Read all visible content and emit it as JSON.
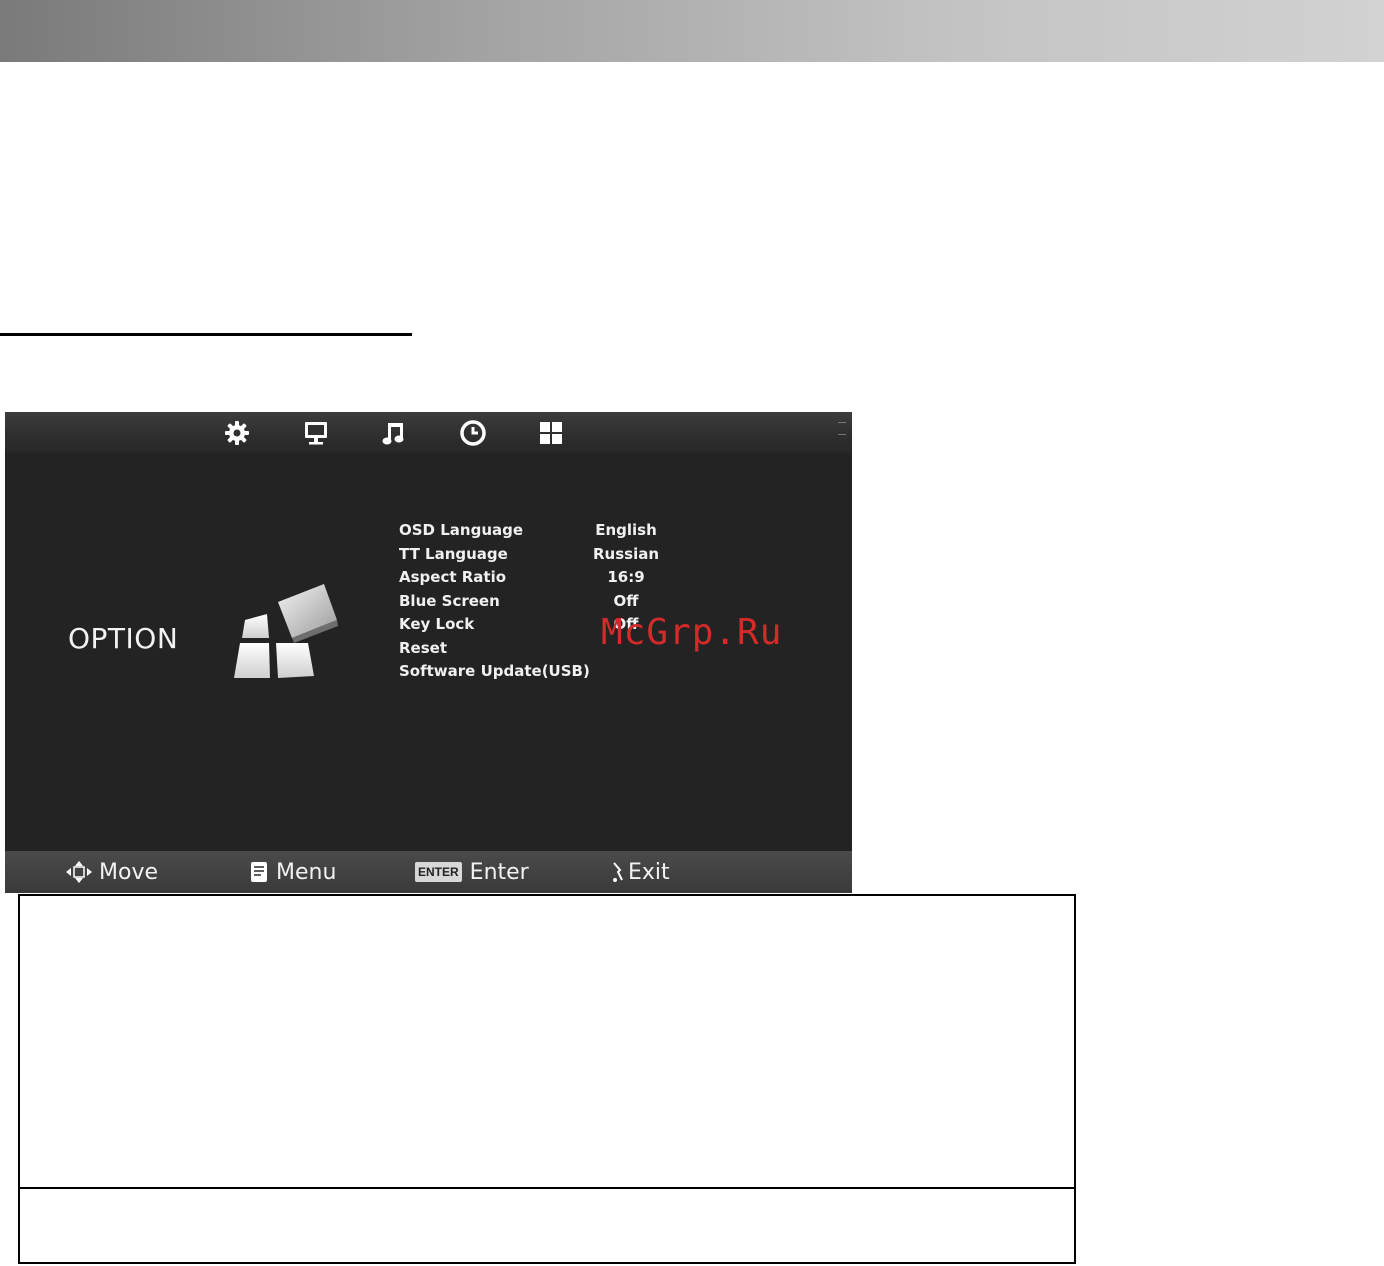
{
  "osd": {
    "tabs": [
      {
        "icon": "gear-icon"
      },
      {
        "icon": "monitor-icon"
      },
      {
        "icon": "music-note-icon"
      },
      {
        "icon": "clock-icon"
      },
      {
        "icon": "grid-icon"
      }
    ],
    "menu_title": "OPTION",
    "settings": [
      {
        "label": "OSD Language",
        "value": "English"
      },
      {
        "label": "TT Language",
        "value": "Russian"
      },
      {
        "label": "Aspect Ratio",
        "value": "16:9"
      },
      {
        "label": "Blue Screen",
        "value": "Off"
      },
      {
        "label": "Key Lock",
        "value": "Off"
      },
      {
        "label": "Reset",
        "value": ""
      },
      {
        "label": "Software Update(USB)",
        "value": ""
      }
    ],
    "watermark": "McGrp.Ru",
    "hints": {
      "move": "Move",
      "menu": "Menu",
      "enter_key": "ENTER",
      "enter": "Enter",
      "exit": "Exit"
    }
  }
}
